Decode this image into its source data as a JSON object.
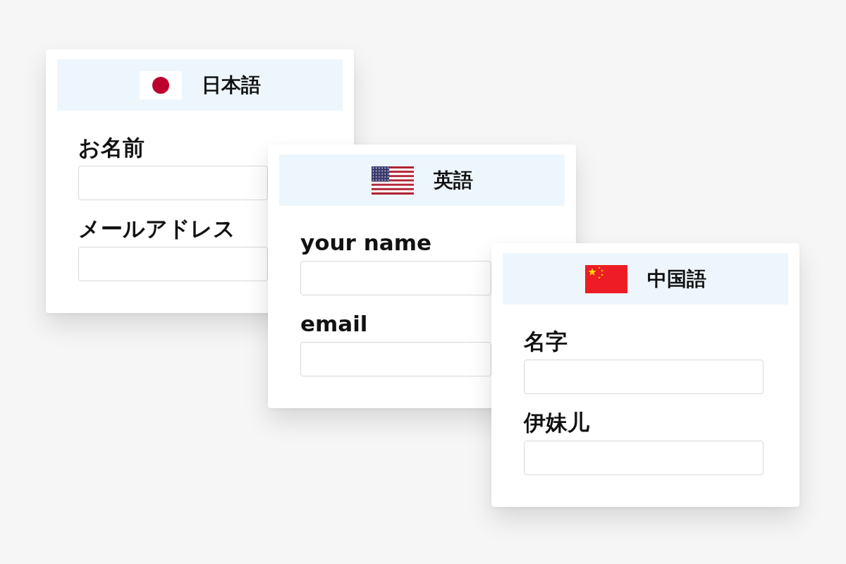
{
  "cards": [
    {
      "language": "日本語",
      "kind": "japan",
      "fields": [
        {
          "label": "お名前"
        },
        {
          "label": "メールアドレス"
        }
      ]
    },
    {
      "language": "英語",
      "kind": "usa",
      "fields": [
        {
          "label": "your name"
        },
        {
          "label": "email"
        }
      ]
    },
    {
      "language": "中国語",
      "kind": "china",
      "fields": [
        {
          "label": "名字"
        },
        {
          "label": "伊妹儿"
        }
      ]
    }
  ]
}
